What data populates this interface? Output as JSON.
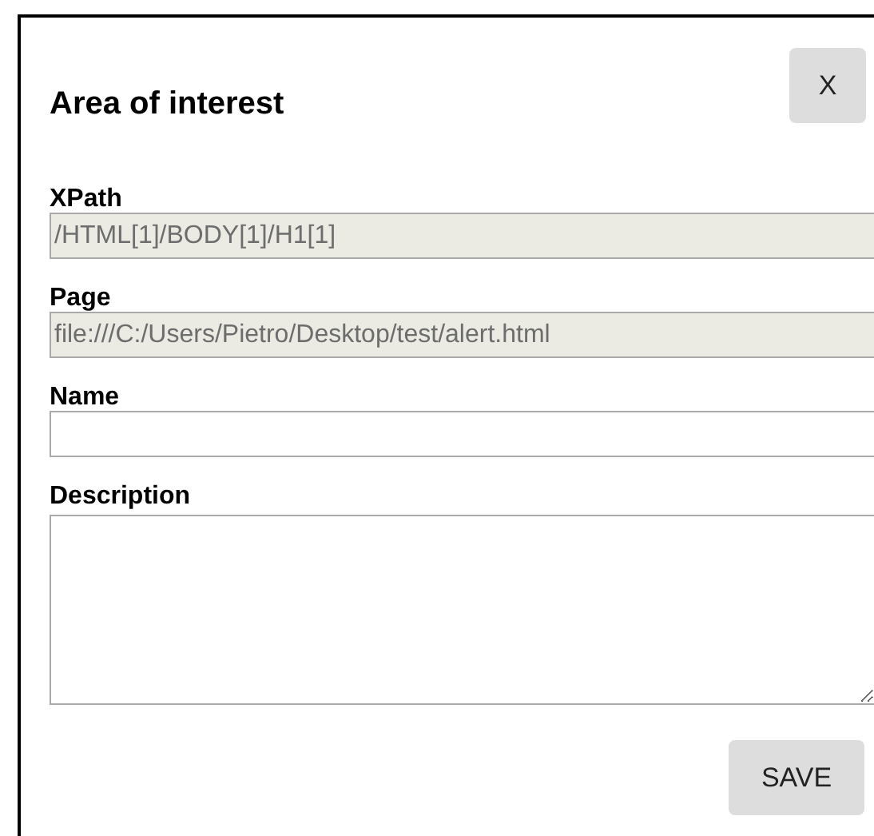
{
  "dialog": {
    "title": "Area of interest",
    "close_button": "X",
    "fields": [
      {
        "label": "XPath",
        "kind": "text",
        "readonly": true,
        "value": "/HTML[1]/BODY[1]/H1[1]"
      },
      {
        "label": "Page",
        "kind": "text",
        "readonly": true,
        "value": "file:///C:/Users/Pietro/Desktop/test/alert.html"
      },
      {
        "label": "Name",
        "kind": "text",
        "readonly": false
      },
      {
        "label": "Description",
        "kind": "textarea",
        "readonly": false
      }
    ],
    "save_button": "SAVE"
  }
}
